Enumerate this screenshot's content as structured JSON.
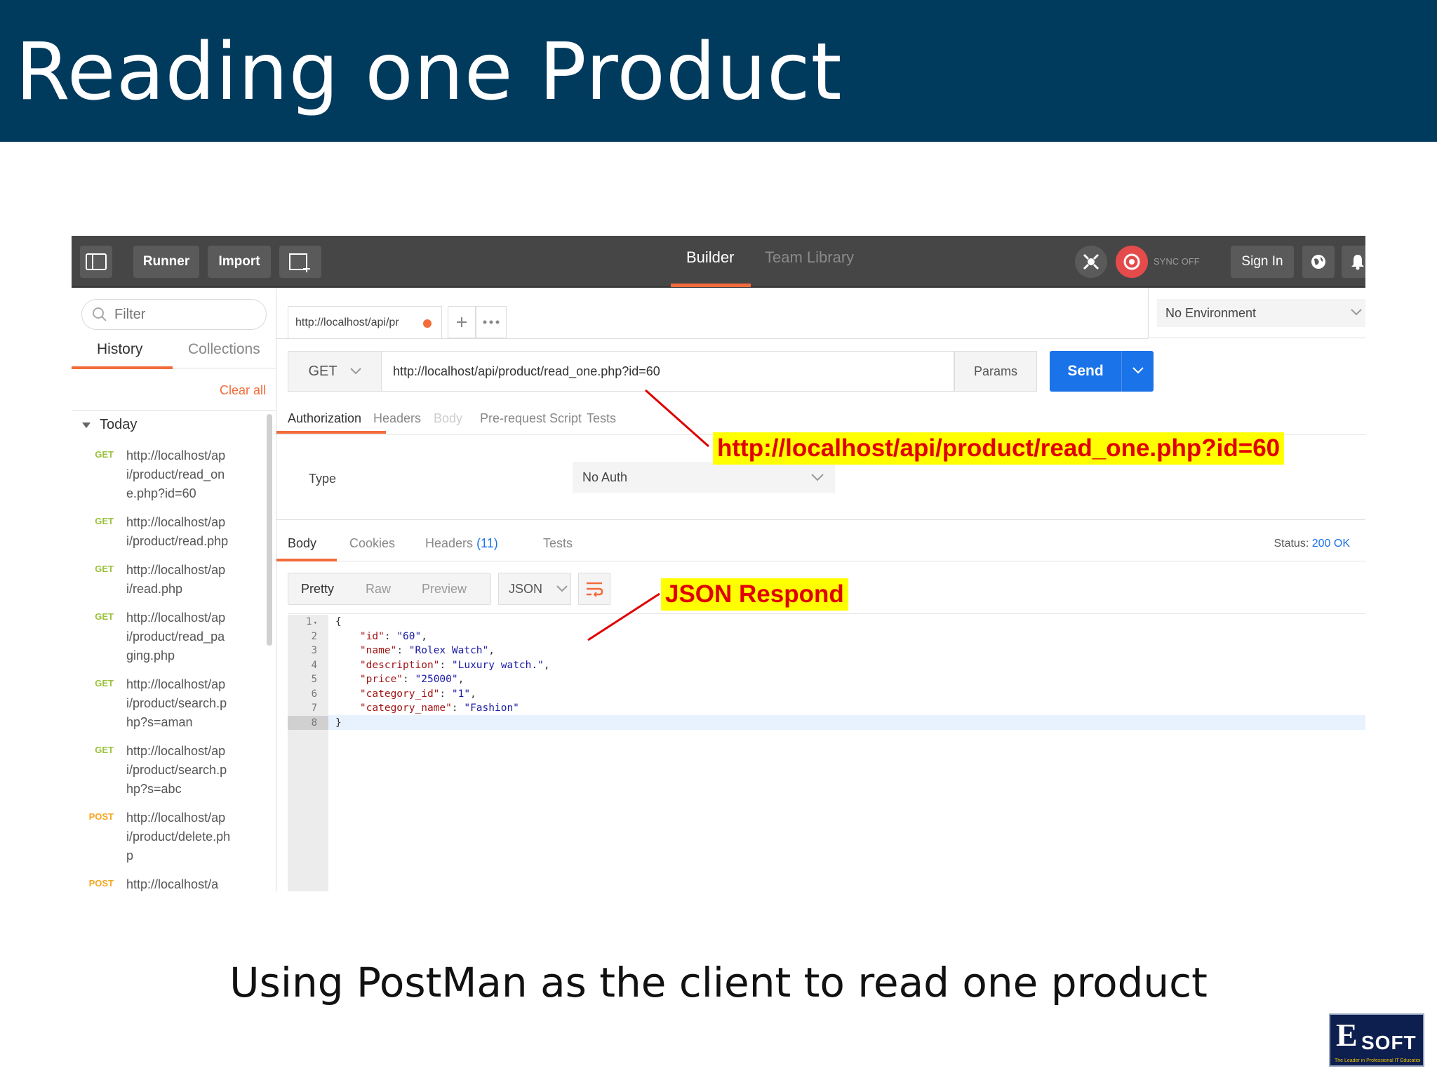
{
  "slide": {
    "title": "Reading one Product",
    "caption": "Using PostMan as the client to read one product"
  },
  "toolbar": {
    "runner_label": "Runner",
    "import_label": "Import",
    "builder_tab": "Builder",
    "team_library_tab": "Team Library",
    "sync_label": "SYNC OFF",
    "sign_in_label": "Sign In"
  },
  "sidebar": {
    "filter_placeholder": "Filter",
    "tabs": [
      "History",
      "Collections"
    ],
    "clear_all": "Clear all",
    "group_label": "Today",
    "history": [
      {
        "method": "GET",
        "url": "http://localhost/api/product/read_one.php?id=60"
      },
      {
        "method": "GET",
        "url": "http://localhost/api/product/read.php"
      },
      {
        "method": "GET",
        "url": "http://localhost/api/read.php"
      },
      {
        "method": "GET",
        "url": "http://localhost/api/product/read_paging.php"
      },
      {
        "method": "GET",
        "url": "http://localhost/api/product/search.php?s=aman"
      },
      {
        "method": "GET",
        "url": "http://localhost/api/product/search.php?s=abc"
      },
      {
        "method": "POST",
        "url": "http://localhost/api/product/delete.php"
      },
      {
        "method": "POST",
        "url": "http://localhost/a"
      }
    ]
  },
  "request": {
    "tab_label": "http://localhost/api/pr",
    "environment": "No Environment",
    "method": "GET",
    "url": "http://localhost/api/product/read_one.php?id=60",
    "params_label": "Params",
    "send_label": "Send",
    "tabs": [
      "Authorization",
      "Headers",
      "Body",
      "Pre-request Script",
      "Tests"
    ],
    "auth_type_label": "Type",
    "auth_type_value": "No Auth"
  },
  "response": {
    "tabs": [
      "Body",
      "Cookies",
      "Headers",
      "Tests"
    ],
    "headers_count": "(11)",
    "status_label": "Status:",
    "status_value": "200 OK",
    "format_tabs": [
      "Pretty",
      "Raw",
      "Preview"
    ],
    "format_select": "JSON",
    "line_numbers": [
      "1",
      "2",
      "3",
      "4",
      "5",
      "6",
      "7",
      "8"
    ],
    "lines": [
      {
        "open": "{"
      },
      {
        "key": "\"id\"",
        "value": "\"60\"",
        "comma": ","
      },
      {
        "key": "\"name\"",
        "value": "\"Rolex Watch\"",
        "comma": ","
      },
      {
        "key": "\"description\"",
        "value": "\"Luxury watch.\"",
        "comma": ","
      },
      {
        "key": "\"price\"",
        "value": "\"25000\"",
        "comma": ","
      },
      {
        "key": "\"category_id\"",
        "value": "\"1\"",
        "comma": ","
      },
      {
        "key": "\"category_name\"",
        "value": "\"Fashion\"",
        "comma": ""
      },
      {
        "open": "}"
      }
    ]
  },
  "annotations": {
    "url_callout": "http://localhost/api/product/read_one.php?id=60",
    "json_callout": "JSON Respond"
  },
  "logo": {
    "first_letter": "E",
    "rest": "SOFT",
    "tagline": "The Leader in Professional IT Education"
  },
  "colors": {
    "title_bar": "#003a5d",
    "accent_orange": "#f26b3a",
    "send_blue": "#1a73e8",
    "get_green": "#9bc23c",
    "post_orange": "#f5a623",
    "callout_yellow": "#ffff00",
    "callout_red": "#e00000"
  }
}
